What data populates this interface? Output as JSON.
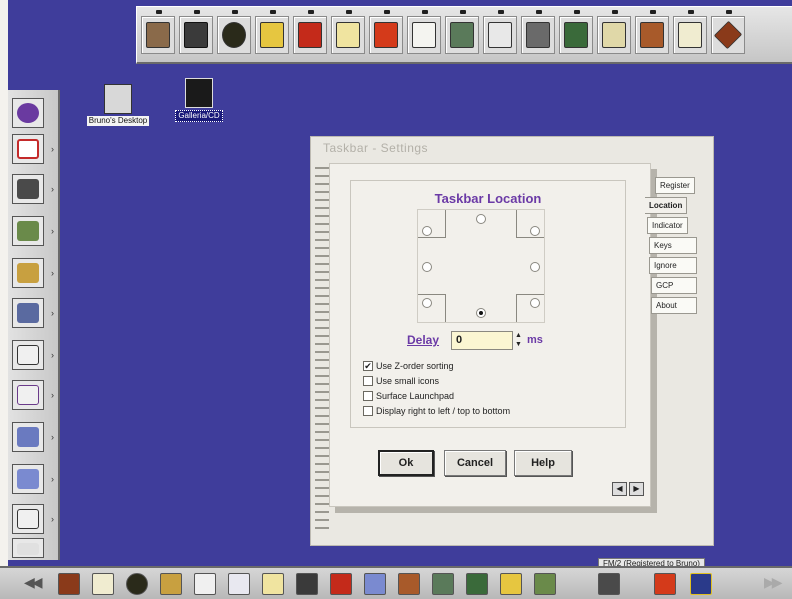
{
  "colors": {
    "desktop": "#3f3d9b",
    "accent_label": "#6b3aa6",
    "delay_field": "#fbf6d2"
  },
  "desktop_icons": [
    {
      "name": "Bruno's Desktop",
      "icon": "desktop-folder-icon"
    },
    {
      "name": "Galleria/CD",
      "icon": "projector-icon"
    }
  ],
  "top_launchpad": {
    "icons": [
      "photo-icon",
      "cabinet-icon",
      "cd-icon",
      "cartoon-icon",
      "eye-icon",
      "folder-icon",
      "fax-icon",
      "card-file-icon",
      "printer-icon",
      "building-icon",
      "binoculars-icon",
      "pen-icon",
      "folder-drawing-icon",
      "gallery-icon",
      "window-icon",
      "diamond-icon"
    ]
  },
  "left_launchpad": {
    "icons": [
      "globe-icon",
      "text-editor-icon",
      "fm-icon",
      "disk-icon",
      "penguin-icon",
      "game-icon",
      "writer-icon",
      "notepad-icon",
      "browser-icon",
      "os2-icon",
      "window-list-icon",
      "printer-icon"
    ]
  },
  "bottom_launchpad": {
    "icons": [
      "diamond-icon",
      "window-icon",
      "cd-icon",
      "penguin-icon",
      "writer-icon",
      "document-icon",
      "folder-icon",
      "star-icon",
      "eye-icon",
      "os2-4052-icon",
      "gallery-icon",
      "bag-icon",
      "pen-icon",
      "cartoon-icon",
      "disk-icon",
      "fm-icon",
      "printer-icon",
      "computer-icon"
    ],
    "status_label": "FM/2 (Registered to Bruno)"
  },
  "window": {
    "title": "Taskbar - Settings",
    "group_title": "Taskbar Location",
    "location_radios": [
      {
        "position": "top-left",
        "selected": false
      },
      {
        "position": "top",
        "selected": false
      },
      {
        "position": "top-right",
        "selected": false
      },
      {
        "position": "left",
        "selected": false
      },
      {
        "position": "right",
        "selected": false
      },
      {
        "position": "bottom-left",
        "selected": false
      },
      {
        "position": "bottom",
        "selected": true
      },
      {
        "position": "bottom-right",
        "selected": false
      }
    ],
    "delay": {
      "label": "Delay",
      "value": "0",
      "unit": "ms"
    },
    "checkboxes": [
      {
        "label": "Use Z-order sorting",
        "checked": true
      },
      {
        "label": "Use small icons",
        "checked": false
      },
      {
        "label": "Surface Launchpad",
        "checked": false
      },
      {
        "label": "Display right to left / top to bottom",
        "checked": false
      }
    ],
    "buttons": {
      "ok": "Ok",
      "cancel": "Cancel",
      "help": "Help"
    },
    "tabs": [
      "Register",
      "Location",
      "Indicator",
      "Keys",
      "Ignore",
      "GCP",
      "About"
    ],
    "active_tab": "Location"
  }
}
